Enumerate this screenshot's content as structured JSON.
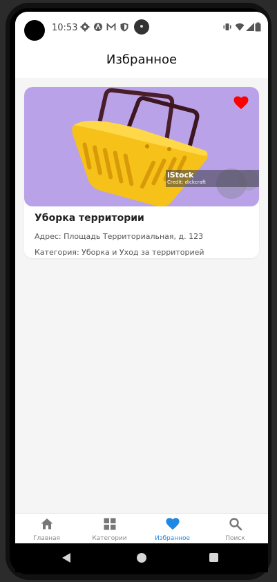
{
  "status_bar": {
    "time": "10:53",
    "icons": [
      "gear-icon",
      "a-icon",
      "mail-icon",
      "shield-icon",
      "notification-dot-icon",
      "vibrate-icon",
      "wifi-icon",
      "signal-icon",
      "battery-icon"
    ]
  },
  "header": {
    "title": "Избранное"
  },
  "card": {
    "image_watermark": {
      "logo": "iStock",
      "credit": "Credit: dickcraft"
    },
    "is_favorite": true,
    "title": "Уборка территории",
    "address": "Адрес: Площадь Территориальная, д. 123",
    "category": "Категория: Уборка и Уход за территорией"
  },
  "bottom_nav": {
    "items": [
      {
        "label": "Главная",
        "icon": "home-icon",
        "active": false
      },
      {
        "label": "Категории",
        "icon": "grid-icon",
        "active": false
      },
      {
        "label": "Избранное",
        "icon": "heart-icon",
        "active": true
      },
      {
        "label": "Поиск",
        "icon": "search-icon",
        "active": false
      }
    ]
  },
  "colors": {
    "accent": "#1e88e5",
    "favorite": "#ff0000",
    "image_background": "#b9a2e8",
    "basket": "#f6c21a"
  }
}
